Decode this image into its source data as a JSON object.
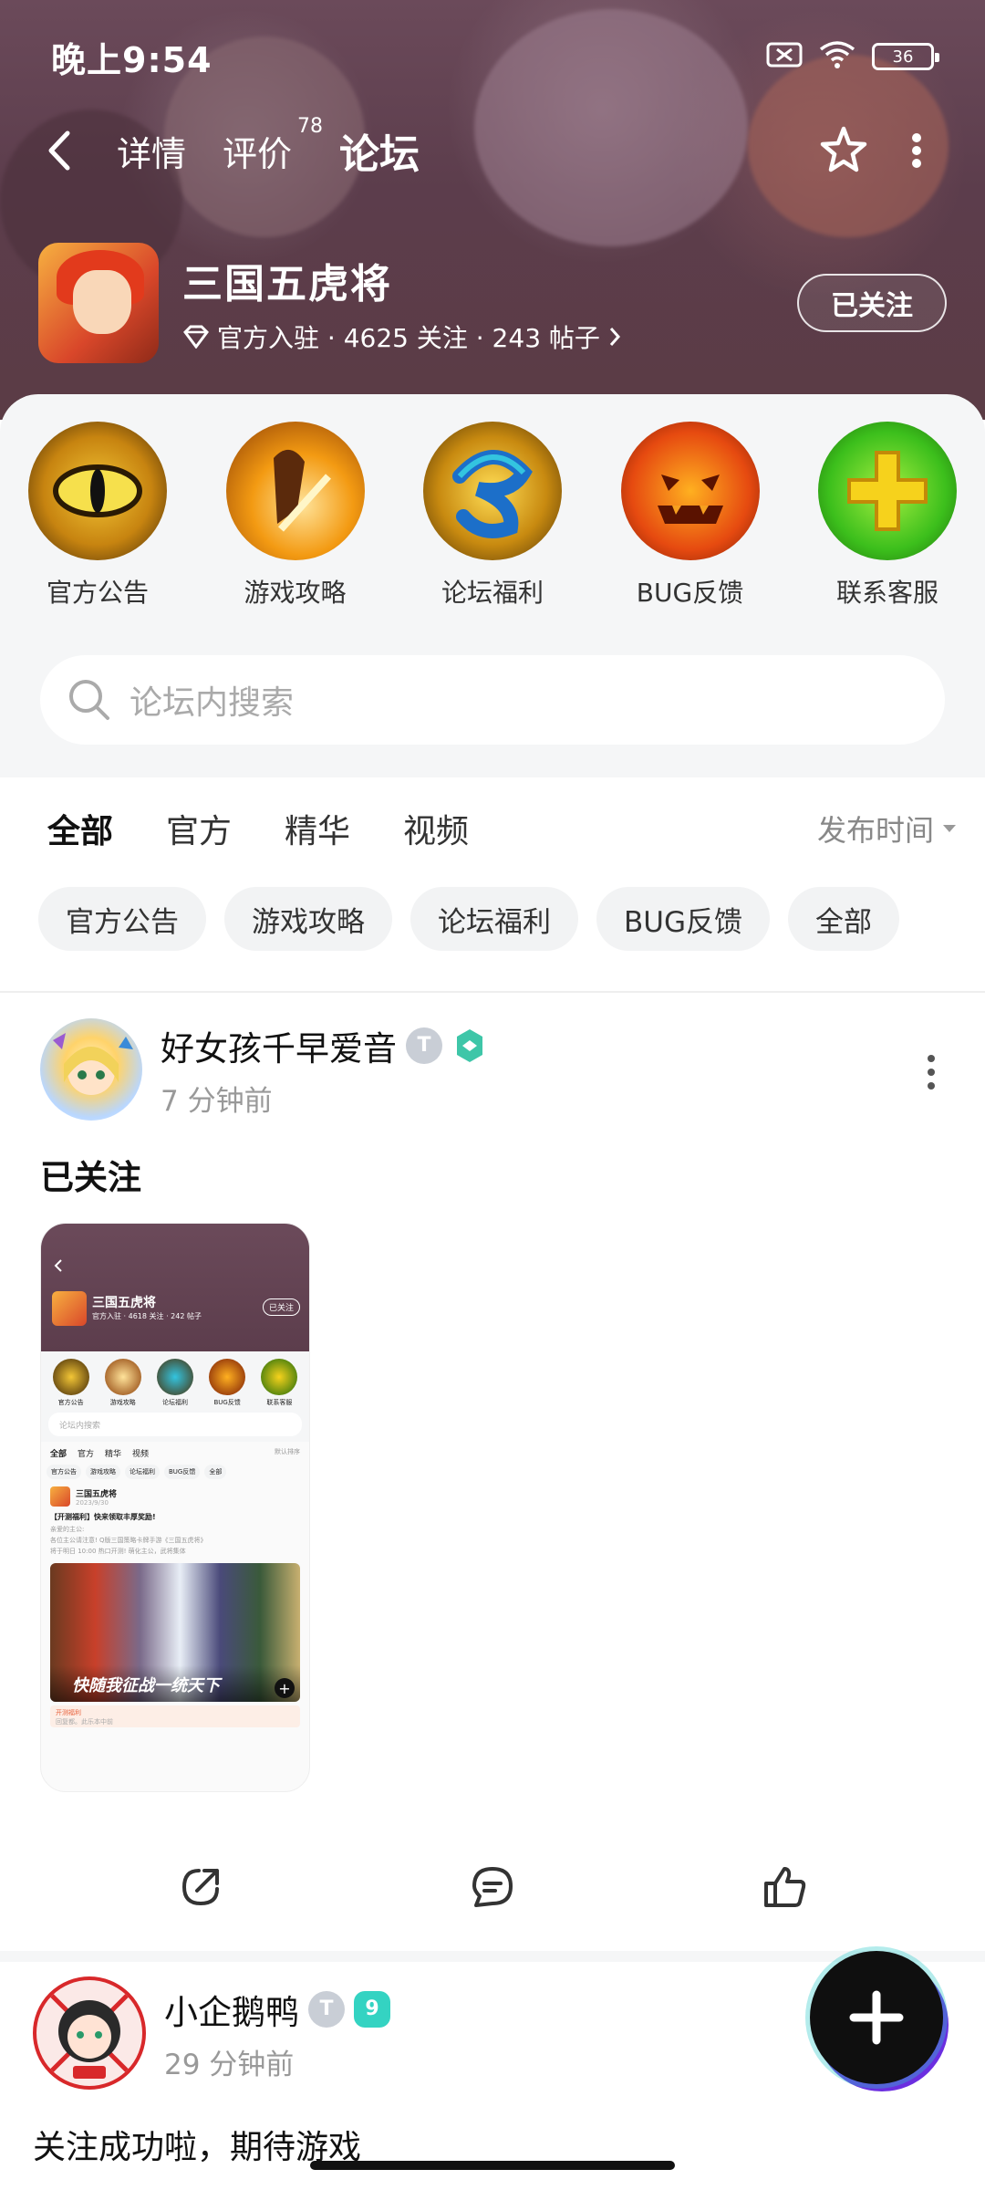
{
  "status_bar": {
    "time": "晚上9:54",
    "battery": "36"
  },
  "nav": {
    "tabs": [
      {
        "label": "详情"
      },
      {
        "label": "评价",
        "badge": "78"
      },
      {
        "label": "论坛"
      }
    ],
    "active_tab": "论坛"
  },
  "game": {
    "title": "三国五虎将",
    "meta": "官方入驻 · 4625 关注 · 243 帖子",
    "follow_label": "已关注"
  },
  "categories": [
    {
      "label": "官方公告",
      "icon": "dragon-eye-icon"
    },
    {
      "label": "游戏攻略",
      "icon": "sword-strike-icon"
    },
    {
      "label": "论坛福利",
      "icon": "blue-gift-icon"
    },
    {
      "label": "BUG反馈",
      "icon": "pumpkin-face-icon"
    },
    {
      "label": "联系客服",
      "icon": "green-cross-icon"
    }
  ],
  "search": {
    "placeholder": "论坛内搜索"
  },
  "filter_tabs": [
    {
      "label": "全部"
    },
    {
      "label": "官方"
    },
    {
      "label": "精华"
    },
    {
      "label": "视频"
    }
  ],
  "sort_label": "发布时间",
  "chips": [
    "官方公告",
    "游戏攻略",
    "论坛福利",
    "BUG反馈",
    "全部"
  ],
  "posts": [
    {
      "username": "好女孩千早爱音",
      "time": "7 分钟前",
      "content": "已关注",
      "level_badge": "T"
    },
    {
      "username": "小企鹅鸭",
      "time": "29 分钟前",
      "content": "关注成功啦，期待游戏",
      "level_badge": "T",
      "level_num": "9"
    }
  ],
  "thumbnail": {
    "title": "三国五虎将",
    "follow": "已关注",
    "meta": "官方入驻 · 4618 关注 · 242 帖子",
    "cats": [
      "官方公告",
      "游戏攻略",
      "论坛福利",
      "BUG反馈",
      "联系客服"
    ],
    "search": "论坛内搜索",
    "tabs": [
      "全部",
      "官方",
      "精华",
      "视频"
    ],
    "sort": "默认排序",
    "chips": [
      "官方公告",
      "游戏攻略",
      "论坛福利",
      "BUG反馈",
      "全部"
    ],
    "post_title": "三国五虎将",
    "post_date": "2023/9/30",
    "post_headline": "【开测福利】快来领取丰厚奖励!",
    "post_line1": "亲爱的主公:",
    "post_line2": "各位主公请注意! Q版三国策略卡牌手游《三国五虎将》",
    "post_line3": "将于明日 10:00 热口开测! 萌化主公，武将集体",
    "banner_text": "快随我征战一统天下",
    "tag": "开测福利",
    "footer": "回复都。此乐本中前"
  },
  "colors": {
    "accent": "#27d8c0",
    "header_bg": "#5c3d4c"
  }
}
